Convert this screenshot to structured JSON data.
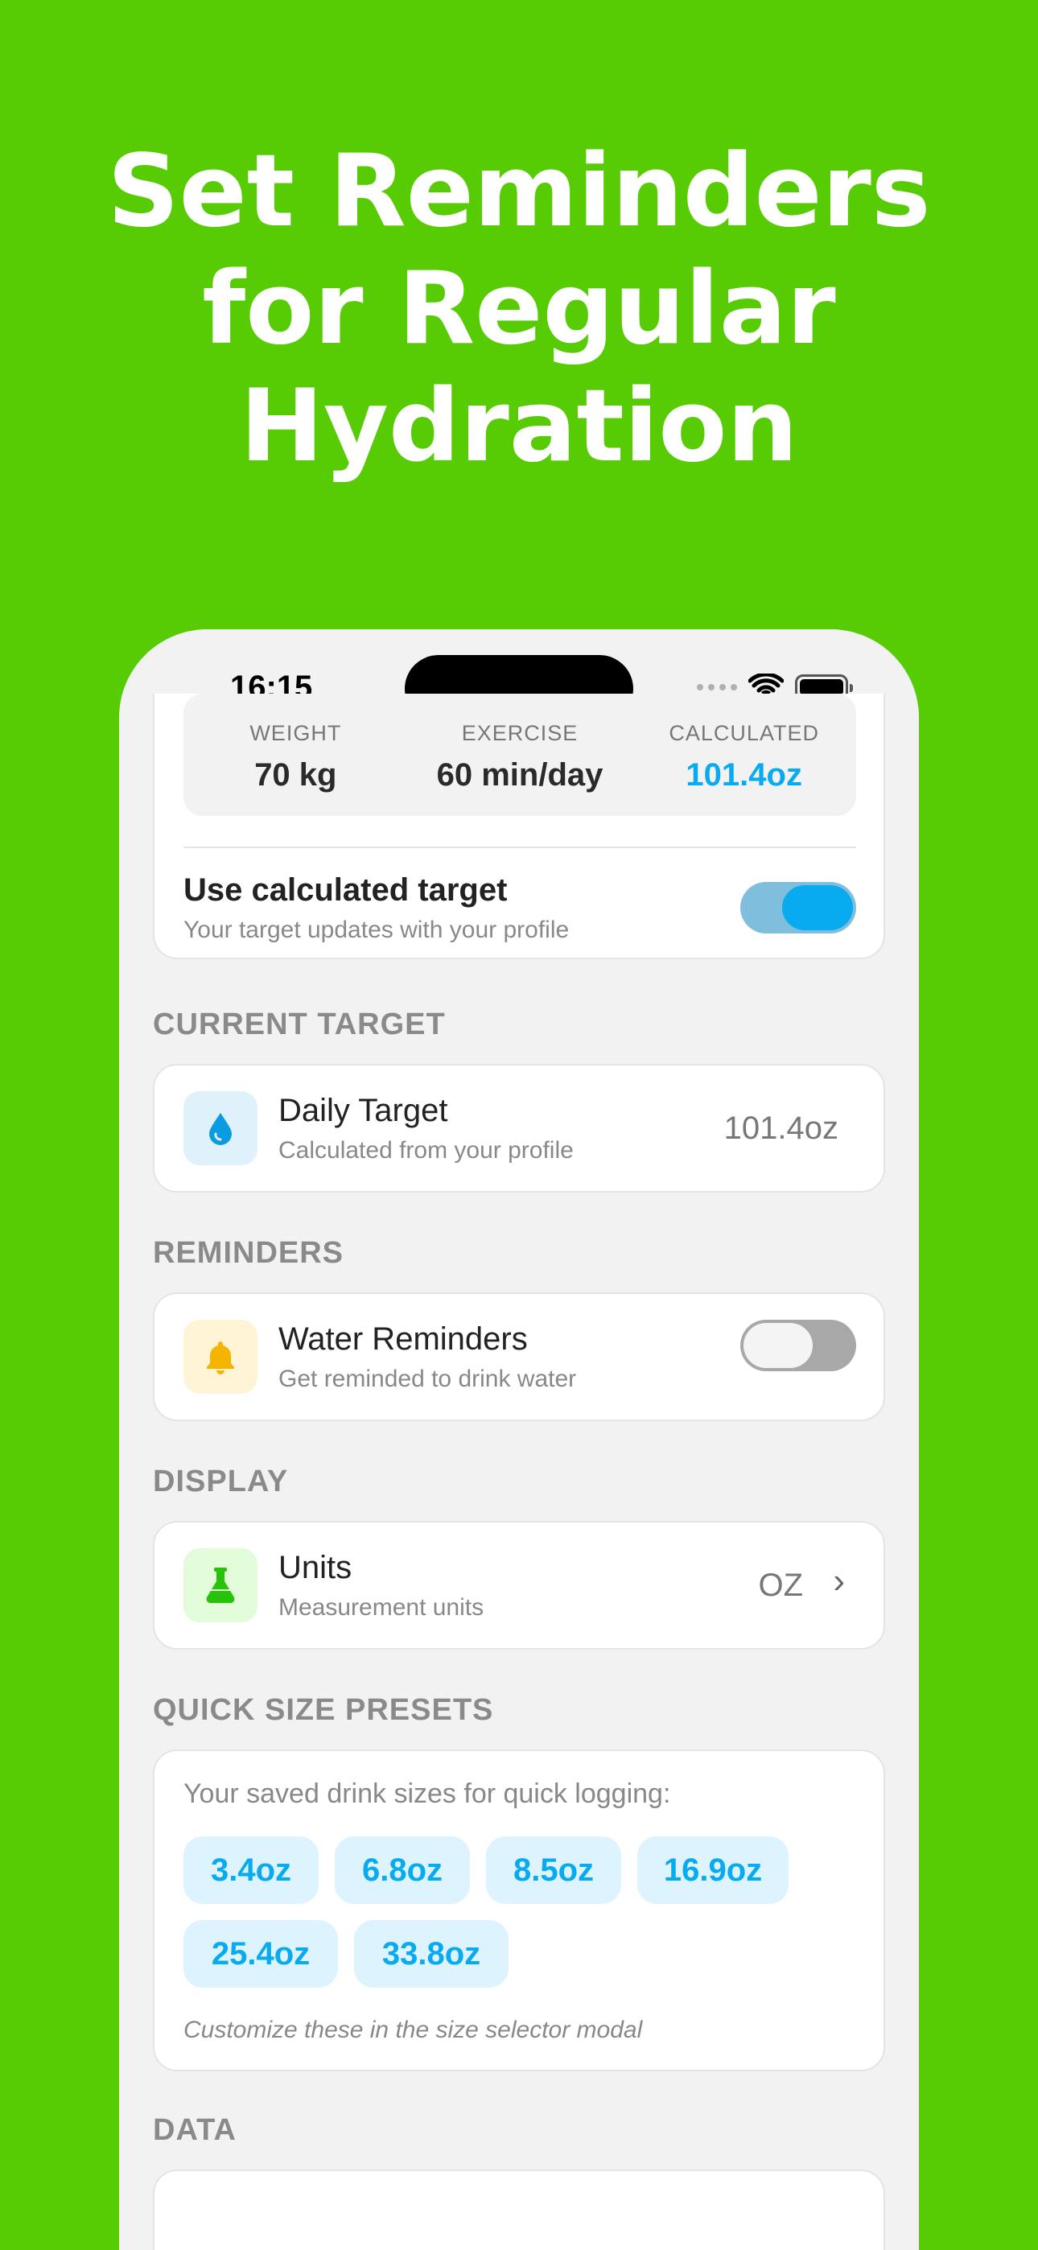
{
  "headline": [
    "Set Reminders",
    "for Regular",
    "Hydration"
  ],
  "status": {
    "time": "16:15"
  },
  "stats": {
    "weight_label": "WEIGHT",
    "weight_value": "70 kg",
    "exercise_label": "EXERCISE",
    "exercise_value": "60 min/day",
    "calculated_label": "CALCULATED",
    "calculated_value": "101.4oz"
  },
  "calc_target": {
    "title": "Use calculated target",
    "subtitle": "Your target updates with your profile",
    "enabled": true
  },
  "sections": {
    "current_target": "CURRENT TARGET",
    "reminders": "REMINDERS",
    "display": "DISPLAY",
    "presets": "QUICK SIZE PRESETS",
    "data": "DATA"
  },
  "daily_target": {
    "title": "Daily Target",
    "subtitle": "Calculated from your profile",
    "value": "101.4oz",
    "icon": "water-drop-icon"
  },
  "water_reminders": {
    "title": "Water Reminders",
    "subtitle": "Get reminded to drink water",
    "enabled": false,
    "icon": "bell-icon"
  },
  "units": {
    "title": "Units",
    "subtitle": "Measurement units",
    "value": "OZ",
    "icon": "flask-icon"
  },
  "presets": {
    "intro": "Your saved drink sizes for quick logging:",
    "chips": [
      "3.4oz",
      "6.8oz",
      "8.5oz",
      "16.9oz",
      "25.4oz",
      "33.8oz"
    ],
    "note": "Customize these in the size selector modal"
  },
  "colors": {
    "background": "#57cc04",
    "accent": "#08aaf0",
    "reminder_icon_bg": "#fff4d6",
    "units_icon_bg": "#e2fbd9",
    "drop_icon_bg": "#dff2fc"
  }
}
